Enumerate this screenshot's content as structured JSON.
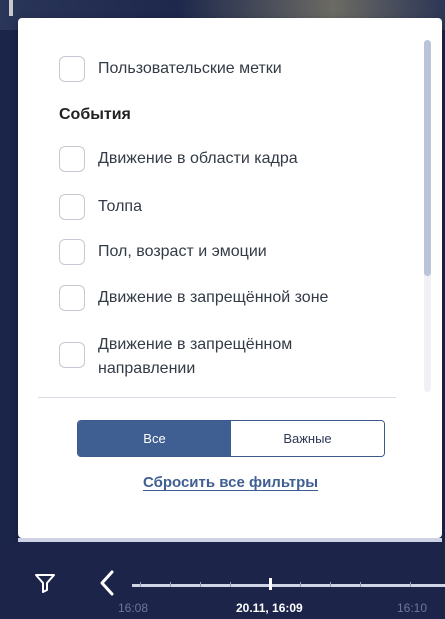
{
  "filters": {
    "custom_marks_label": "Пользовательские метки",
    "events_title": "События",
    "events": [
      {
        "label": "Движение в области кадра",
        "checked": false
      },
      {
        "label": "Толпа",
        "checked": false
      },
      {
        "label": "Пол, возраст и эмоции",
        "checked": false
      },
      {
        "label": "Движение в запрещённой зоне",
        "checked": false
      },
      {
        "label": "Движение в запрещённом направлении",
        "checked": false
      }
    ],
    "scope_options": [
      "Все",
      "Важные"
    ],
    "scope_selected": "Все",
    "reset_label": "Сбросить все фильтры"
  },
  "timeline": {
    "labels": [
      "16:08",
      "20.11, 16:09",
      "16:10"
    ],
    "current_label": "20.11, 16:09"
  },
  "icons": {
    "filter": "filter-icon",
    "previous": "chevron-left-icon"
  },
  "colors": {
    "accent": "#3f5e92",
    "background": "#1c2549",
    "panel": "#ffffff"
  }
}
